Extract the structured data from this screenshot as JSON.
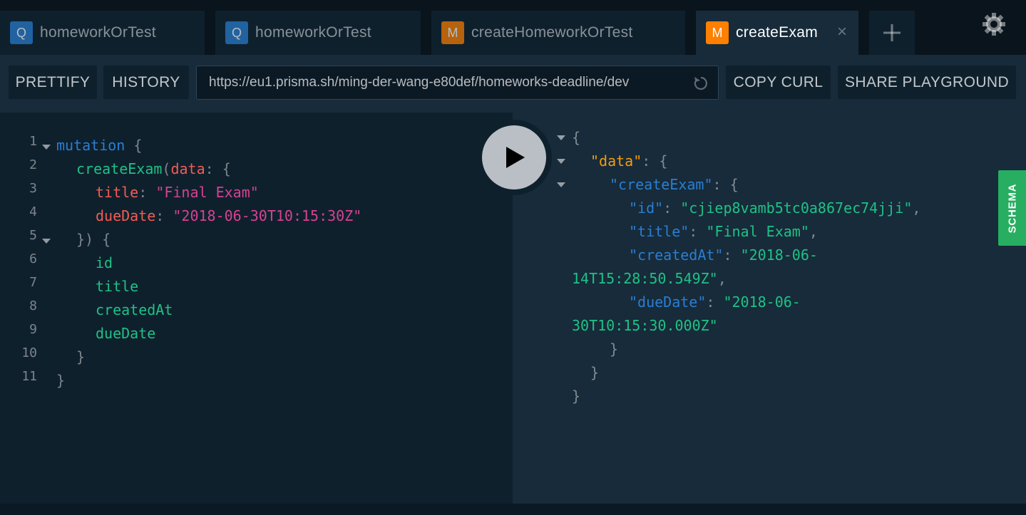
{
  "tabs": [
    {
      "type": "Q",
      "label": "homeworkOrTest"
    },
    {
      "type": "Q",
      "label": "homeworkOrTest"
    },
    {
      "type": "M",
      "label": "createHomeworkOrTest"
    },
    {
      "type": "M",
      "label": "createExam"
    }
  ],
  "tab_close_glyph": "×",
  "tab_add_icon": "plus-icon",
  "settings_icon": "gear-icon",
  "toolbar": {
    "prettify": "PRETTIFY",
    "history": "HISTORY",
    "url": "https://eu1.prisma.sh/ming-der-wang-e80def/homeworks-deadline/dev",
    "copy_curl": "COPY CURL",
    "share": "SHARE PLAYGROUND"
  },
  "editor": {
    "line_numbers": [
      "1",
      "2",
      "3",
      "4",
      "5",
      "6",
      "7",
      "8",
      "9",
      "10",
      "11"
    ],
    "l1_kw": "mutation",
    "l1_brace": " {",
    "l2_fn": "createExam",
    "l2_paren": "(",
    "l2_arg": "data",
    "l2_rest": ": {",
    "l3_key": "title",
    "l3_colon": ": ",
    "l3_val": "\"Final Exam\"",
    "l4_key": "dueDate",
    "l4_colon": ": ",
    "l4_val": "\"2018-06-30T10:15:30Z\"",
    "l5": "}) {",
    "l6": "id",
    "l7": "title",
    "l8": "createdAt",
    "l9": "dueDate",
    "l10": "}",
    "l11": "}"
  },
  "result": {
    "open": "{",
    "data_key": "\"data\"",
    "colon_brace": ": {",
    "create_key": "\"createExam\"",
    "id_key": "\"id\"",
    "id_val": "\"cjiep8vamb5tc0a867ec74jji\"",
    "title_key": "\"title\"",
    "title_val": "\"Final Exam\"",
    "created_key": "\"createdAt\"",
    "created_val_a": "\"2018-06-",
    "created_val_b": "14T15:28:50.549Z\"",
    "due_key": "\"dueDate\"",
    "due_val_a": "\"2018-06-",
    "due_val_b": "30T10:15:30.000Z\"",
    "colon": ": ",
    "comma": ",",
    "close": "}"
  },
  "run_icon": "play-icon",
  "schema_label": "SCHEMA",
  "colors": {
    "query_badge": "#2a7ed2",
    "mutation_badge": "#ff7f00",
    "schema": "#27ae60"
  }
}
